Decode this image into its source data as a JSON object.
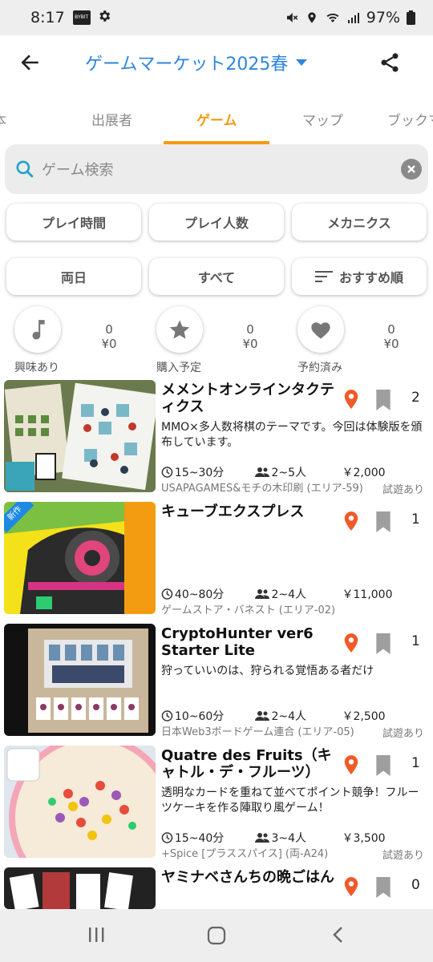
{
  "status": {
    "time": "8:17",
    "badge": "BYBIT",
    "battery": "97%"
  },
  "header": {
    "title": "ゲームマーケット2025春"
  },
  "tabs": [
    {
      "label": "基本"
    },
    {
      "label": "出展者"
    },
    {
      "label": "ゲーム"
    },
    {
      "label": "マップ"
    },
    {
      "label": "ブックマーク"
    }
  ],
  "active_tab": "ゲーム",
  "search": {
    "placeholder": "ゲーム検索"
  },
  "filters": {
    "row1": [
      "プレイ時間",
      "プレイ人数",
      "メカニクス"
    ],
    "row2": [
      "両日",
      "すべて",
      "おすすめ順"
    ]
  },
  "stats": [
    {
      "label": "興味あり",
      "count": "0",
      "amount": "¥0",
      "icon": "music-note-icon"
    },
    {
      "label": "購入予定",
      "count": "0",
      "amount": "¥0",
      "icon": "star-icon"
    },
    {
      "label": "予約済み",
      "count": "0",
      "amount": "¥0",
      "icon": "heart-icon"
    }
  ],
  "accent": "#f39c12",
  "brand": "#2e86de",
  "pin_color": "#f05a28",
  "games": [
    {
      "name": "メメントオンラインタクティクス",
      "desc": "MMO×多人数将棋のテーマです。今回は体験版を頒布しています。",
      "duration": "15~30分",
      "players": "2~5人",
      "price": "￥2,000",
      "exhibitor": "USAPAGAMES&モチの木印刷 (エリア-59)",
      "trial": "試遊あり",
      "count": "2"
    },
    {
      "name": "キューブエクスプレス",
      "desc": "",
      "duration": "40~80分",
      "players": "2~4人",
      "price": "￥11,000",
      "exhibitor": "ゲームストア・バネスト (エリア-02)",
      "trial": "",
      "count": "1",
      "badge": "新作"
    },
    {
      "name": "CryptoHunter ver6 Starter Lite",
      "desc": "狩っていいのは、狩られる覚悟ある者だけ",
      "duration": "10~60分",
      "players": "2~4人",
      "price": "￥2,500",
      "exhibitor": "日本Web3ボードゲーム連合 (エリア-05)",
      "trial": "試遊あり",
      "count": "1"
    },
    {
      "name": "Quatre des Fruits（キャトル・デ・フルーツ）",
      "desc": "透明なカードを重ねて並べてポイント競争！フルーツケーキを作る陣取り風ゲーム！",
      "duration": "15~40分",
      "players": "3~4人",
      "price": "￥3,500",
      "exhibitor": "+Spice [プラススパイス] (両-A24)",
      "trial": "試遊あり",
      "count": "1"
    },
    {
      "name": "ヤミナベさんちの晩ごはん",
      "desc": "",
      "duration": "",
      "players": "",
      "price": "",
      "exhibitor": "",
      "trial": "",
      "count": "0"
    }
  ]
}
